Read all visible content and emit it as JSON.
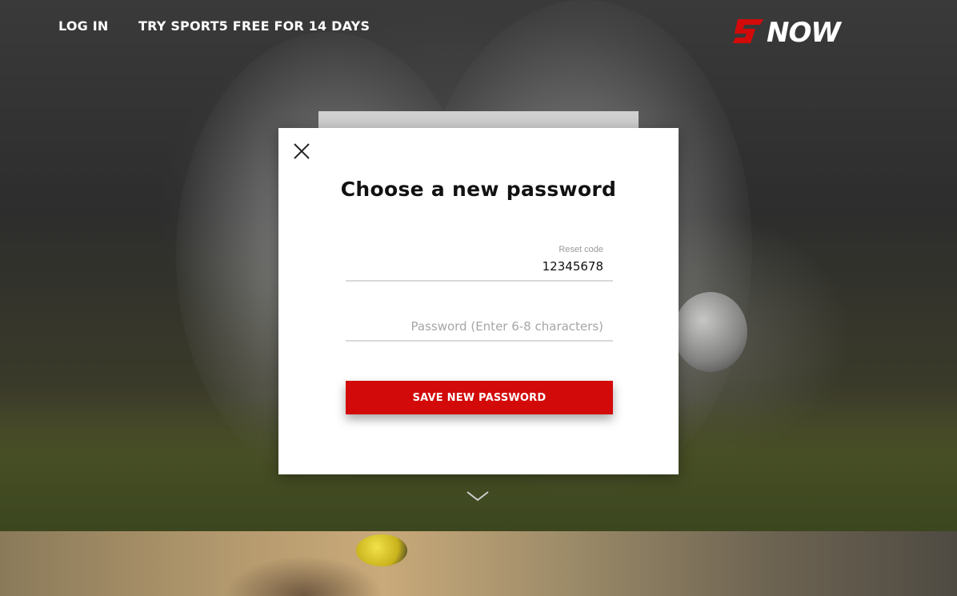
{
  "header": {
    "login_label": "LOG IN",
    "trial_label": "TRY SPORT5 FREE FOR 14 DAYS",
    "logo_text": "NOW"
  },
  "modal": {
    "title": "Choose a new password",
    "close_icon": "close-icon",
    "reset_code": {
      "label": "Reset code",
      "value": "12345678"
    },
    "password": {
      "placeholder": "Password (Enter 6-8 characters)",
      "value": ""
    },
    "submit_label": "SAVE NEW PASSWORD"
  },
  "colors": {
    "accent": "#d30a0a",
    "modal_bg": "#ffffff",
    "text_dark": "#111111"
  },
  "icons": {
    "scroll": "chevron-down-icon",
    "close": "close-icon"
  }
}
